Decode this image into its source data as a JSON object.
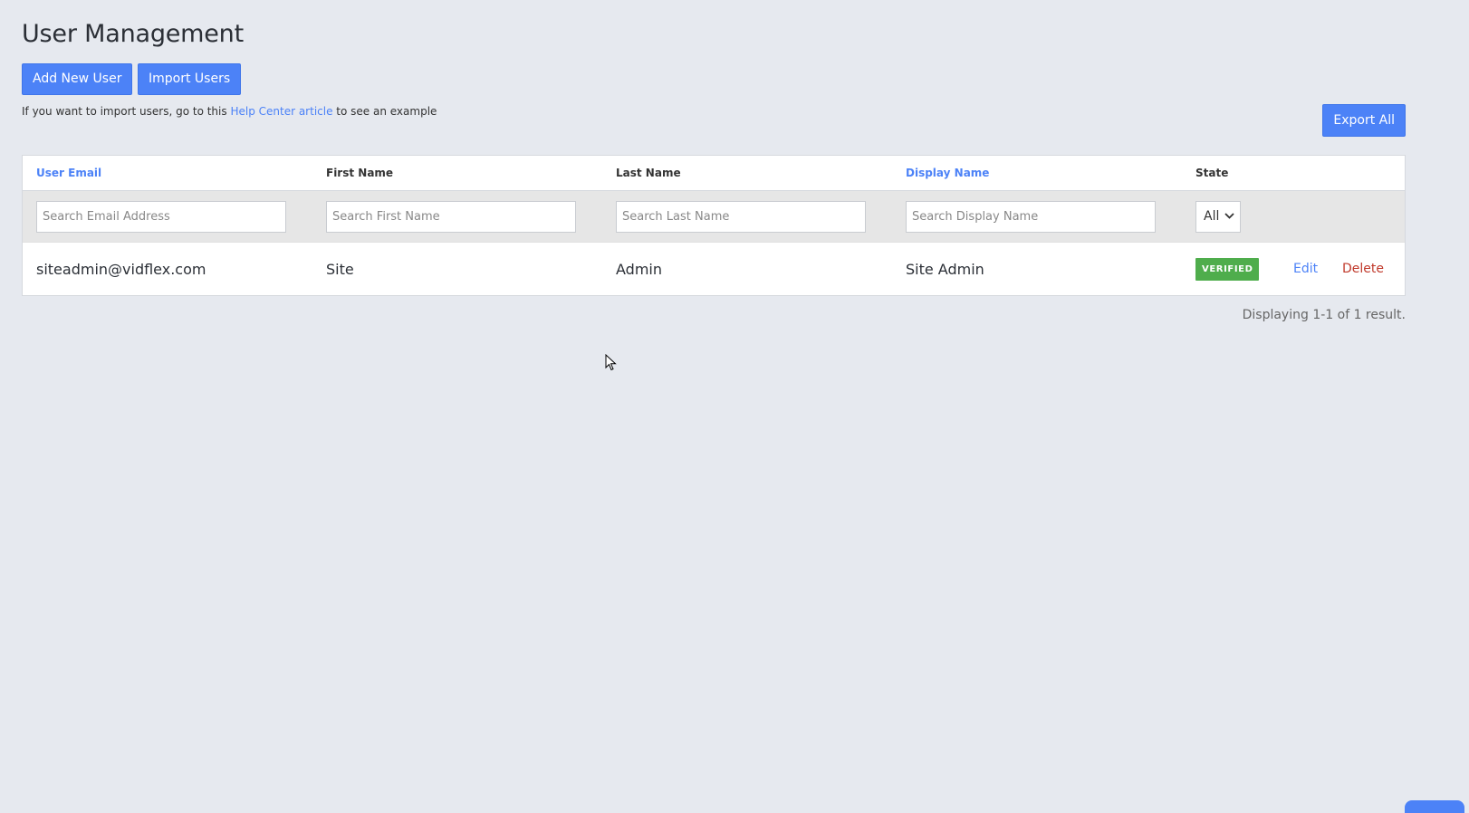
{
  "page": {
    "title": "User Management"
  },
  "actions": {
    "add_user": "Add New User",
    "import_users": "Import Users",
    "export_all": "Export All"
  },
  "help": {
    "prefix": "If you want to import users, go to this",
    "link": "Help Center article",
    "suffix": "to see an example"
  },
  "table": {
    "columns": [
      {
        "label": "User Email",
        "sortable": true
      },
      {
        "label": "First Name",
        "sortable": false
      },
      {
        "label": "Last Name",
        "sortable": false
      },
      {
        "label": "Display Name",
        "sortable": true
      },
      {
        "label": "State",
        "sortable": false
      }
    ],
    "filters": {
      "email_placeholder": "Search Email Address",
      "first_placeholder": "Search First Name",
      "last_placeholder": "Search Last Name",
      "display_placeholder": "Search Display Name",
      "state_value": "All"
    },
    "rows": [
      {
        "email": "siteadmin@vidflex.com",
        "first_name": "Site",
        "last_name": "Admin",
        "display_name": "Site Admin",
        "state": "VERIFIED",
        "edit": "Edit",
        "delete": "Delete"
      }
    ]
  },
  "pagination": {
    "summary": "Displaying 1-1 of 1 result."
  },
  "colors": {
    "accent": "#4c82f7",
    "verified": "#4fad4c",
    "delete": "#c0392b",
    "background": "#e6e9ef"
  }
}
